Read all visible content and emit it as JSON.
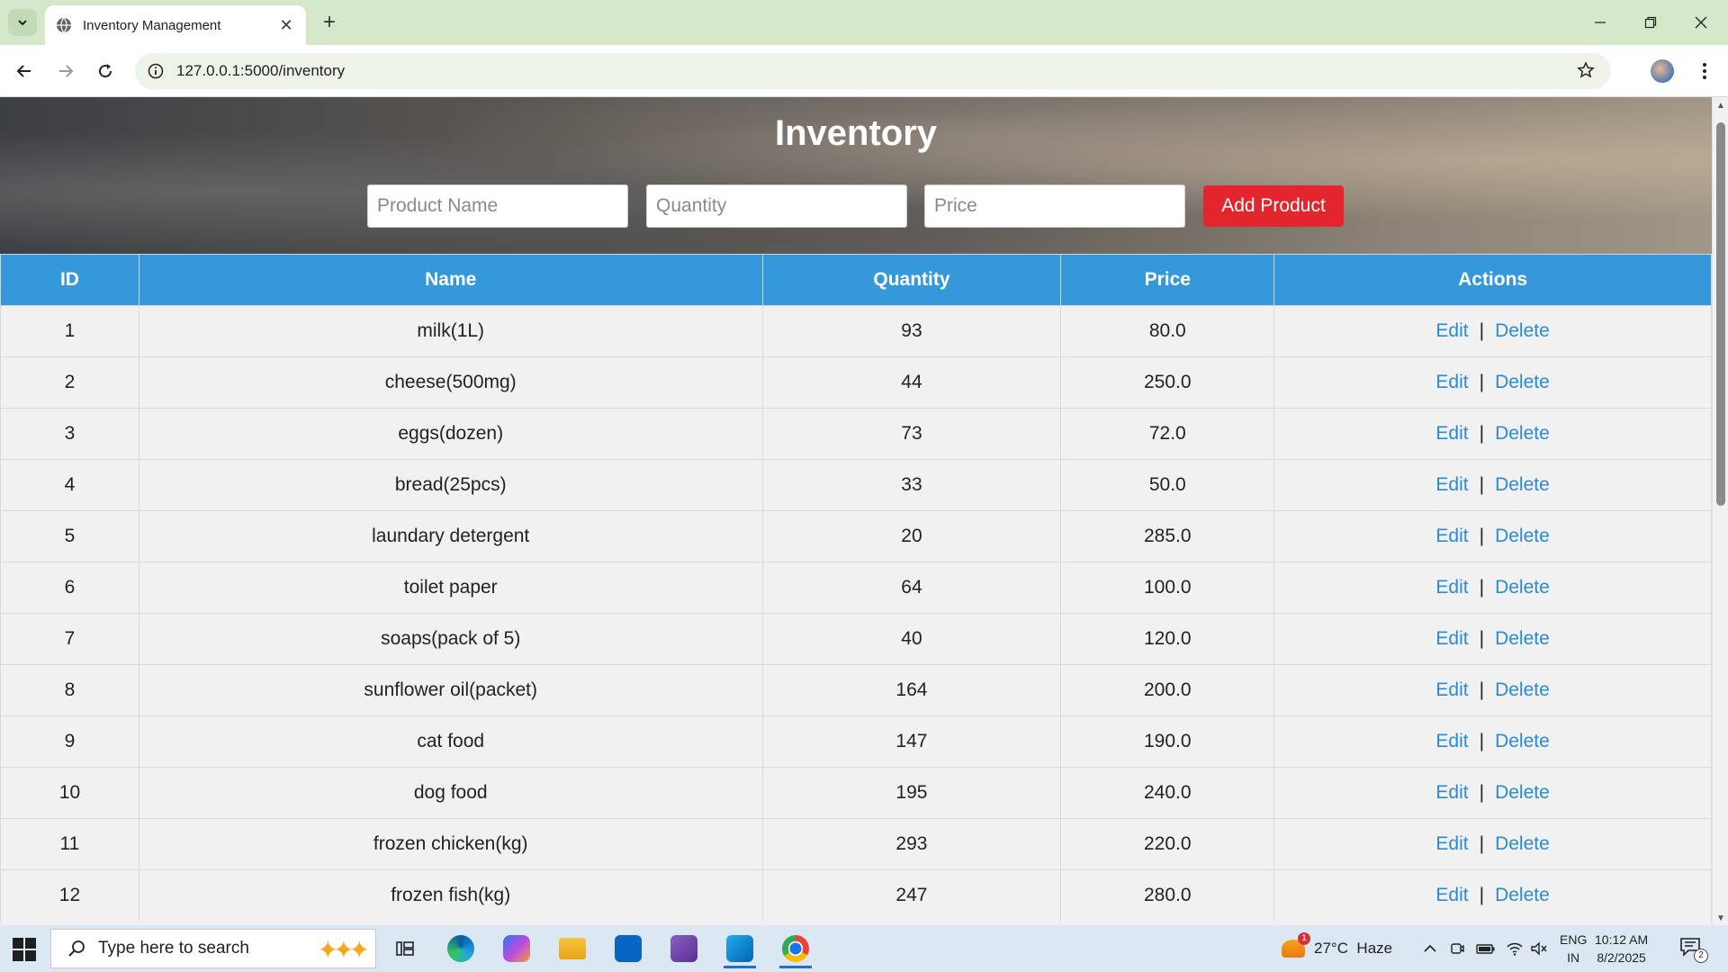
{
  "browser": {
    "tab_title": "Inventory Management",
    "url": "127.0.0.1:5000/inventory",
    "new_tab_label": "+"
  },
  "page": {
    "title": "Inventory",
    "form": {
      "name_placeholder": "Product Name",
      "quantity_placeholder": "Quantity",
      "price_placeholder": "Price",
      "add_label": "Add Product"
    },
    "table": {
      "headers": [
        "ID",
        "Name",
        "Quantity",
        "Price",
        "Actions"
      ],
      "edit_label": "Edit",
      "separator": "|",
      "delete_label": "Delete",
      "rows": [
        {
          "id": "1",
          "name": "milk(1L)",
          "quantity": "93",
          "price": "80.0"
        },
        {
          "id": "2",
          "name": "cheese(500mg)",
          "quantity": "44",
          "price": "250.0"
        },
        {
          "id": "3",
          "name": "eggs(dozen)",
          "quantity": "73",
          "price": "72.0"
        },
        {
          "id": "4",
          "name": "bread(25pcs)",
          "quantity": "33",
          "price": "50.0"
        },
        {
          "id": "5",
          "name": "laundary detergent",
          "quantity": "20",
          "price": "285.0"
        },
        {
          "id": "6",
          "name": "toilet paper",
          "quantity": "64",
          "price": "100.0"
        },
        {
          "id": "7",
          "name": "soaps(pack of 5)",
          "quantity": "40",
          "price": "120.0"
        },
        {
          "id": "8",
          "name": "sunflower oil(packet)",
          "quantity": "164",
          "price": "200.0"
        },
        {
          "id": "9",
          "name": "cat food",
          "quantity": "147",
          "price": "190.0"
        },
        {
          "id": "10",
          "name": "dog food",
          "quantity": "195",
          "price": "240.0"
        },
        {
          "id": "11",
          "name": "frozen chicken(kg)",
          "quantity": "293",
          "price": "220.0"
        },
        {
          "id": "12",
          "name": "frozen fish(kg)",
          "quantity": "247",
          "price": "280.0"
        }
      ]
    }
  },
  "taskbar": {
    "search_placeholder": "Type here to search",
    "weather_text": "27°C  Haze",
    "weather_badge": "1",
    "lang_line1": "ENG",
    "lang_line2": "IN",
    "time": "10:12 AM",
    "date": "8/2/2025",
    "notification_count": "2"
  },
  "colors": {
    "table_header": "#3498db",
    "add_button": "#e3262d",
    "link": "#2a8ad6",
    "tabstrip": "#d4e7c9"
  }
}
